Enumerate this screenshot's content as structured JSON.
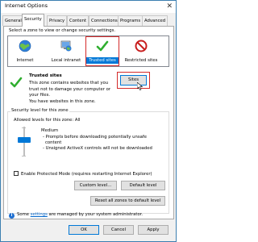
{
  "window": {
    "title": "Internet Options",
    "close_glyph": "✕"
  },
  "tabs": [
    "General",
    "Security",
    "Privacy",
    "Content",
    "Connections",
    "Programs",
    "Advanced"
  ],
  "zones": {
    "prompt": "Select a zone to view or change security settings.",
    "items": [
      {
        "label": "Internet",
        "icon": "globe-icon"
      },
      {
        "label": "Local intranet",
        "icon": "intranet-icon"
      },
      {
        "label": "Trusted sites",
        "icon": "checkmark-icon"
      },
      {
        "label": "Restricted sites",
        "icon": "prohibited-icon"
      }
    ],
    "selected": "Trusted sites"
  },
  "zone_info": {
    "title": "Trusted sites",
    "description": "This zone contains websites that you trust not to damage your computer or your files.",
    "note": "You have websites in this zone.",
    "sites_button": "Sites"
  },
  "security_level": {
    "group_label": "Security level for this zone",
    "allowed_label": "Allowed levels for this zone: All",
    "level_name": "Medium",
    "lines": [
      "- Prompts before downloading potentially unsafe",
      "  content",
      "- Unsigned ActiveX controls will not be downloaded"
    ],
    "protected_mode_label": "Enable Protected Mode (requires restarting Internet Explorer)",
    "protected_mode_checked": false,
    "custom_level_button": "Custom level...",
    "default_level_button": "Default level",
    "reset_all_button": "Reset all zones to default level"
  },
  "notice": {
    "prefix": "Some ",
    "link": "settings",
    "suffix": " are managed by your system administrator."
  },
  "footer": {
    "ok": "OK",
    "cancel": "Cancel",
    "apply": "Apply"
  },
  "colors": {
    "accent": "#0078d7",
    "highlight_outline": "#d42a2a",
    "trusted_check": "#2fae2f",
    "restricted": "#c81e1e"
  }
}
